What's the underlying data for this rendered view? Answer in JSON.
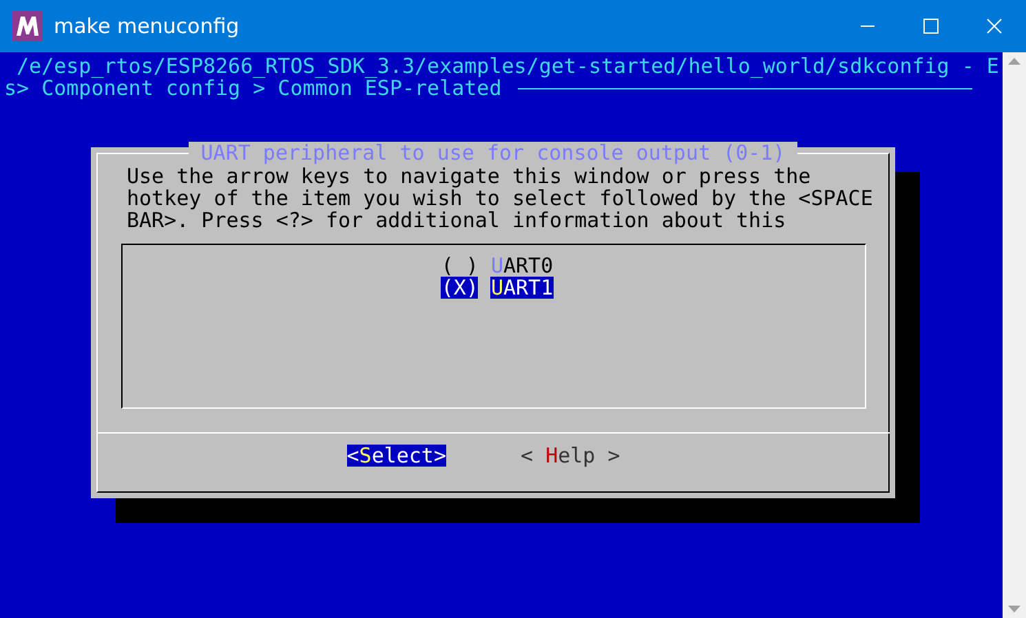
{
  "window": {
    "title": "make menuconfig"
  },
  "terminal": {
    "path_line": " /e/esp_rtos/ESP8266_RTOS_SDK_3.3/examples/get-started/hello_world/sdkconfig - E",
    "breadcrumb": "s> Component config > Common ESP-related"
  },
  "dialog": {
    "title": "UART peripheral to use for console output (0-1)",
    "instructions": "Use the arrow keys to navigate this window or press the hotkey of the item you wish to select followed by the <SPACE BAR>. Press <?> for additional information about this",
    "options": [
      {
        "marker": "( )",
        "hotkey": "U",
        "rest": "ART0",
        "selected": false
      },
      {
        "marker": "(X)",
        "hotkey": "U",
        "rest": "ART1",
        "selected": true
      }
    ],
    "buttons": [
      {
        "before": "<",
        "hotkey": "S",
        "after": "elect>",
        "selected": true
      },
      {
        "before": "< ",
        "hotkey": "H",
        "after": "elp >",
        "selected": false
      }
    ]
  }
}
